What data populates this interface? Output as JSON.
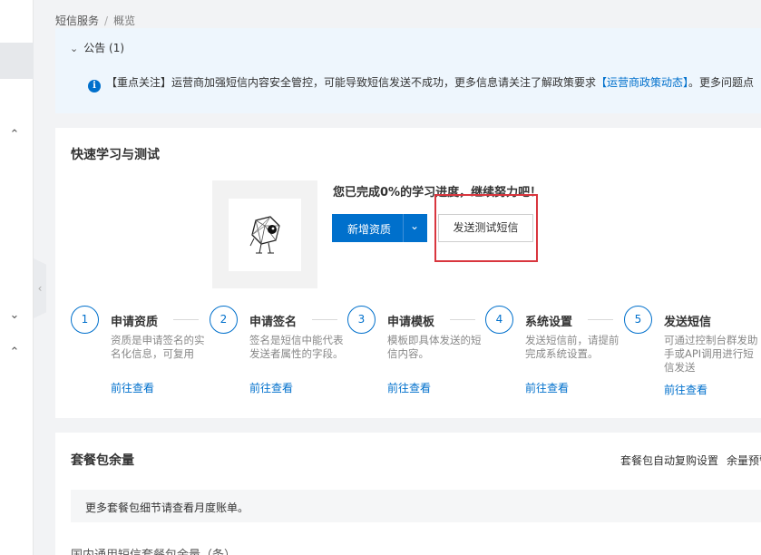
{
  "breadcrumb": {
    "root": "短信服务",
    "separator": "/",
    "current": "概览"
  },
  "notice": {
    "header": "公告 (1)",
    "text_part1": "【重点关注】运营商加强短信内容安全管控，可能导致短信发送不成功，更多信息请关注了解政策要求",
    "link": "【运营商政策动态】",
    "text_part2": "。更多问题点",
    "icon": "info-icon"
  },
  "quick_start": {
    "title": "快速学习与测试",
    "progress_text": "您已完成0%的学习进度，继续努力吧！",
    "add_qualification_button": "新增资质",
    "send_test_button": "发送测试短信",
    "steps": [
      {
        "num": "1",
        "title": "申请资质",
        "desc": "资质是申请签名的实名化信息，可复用",
        "link": "前往查看"
      },
      {
        "num": "2",
        "title": "申请签名",
        "desc": "签名是短信中能代表发送者属性的字段。",
        "link": "前往查看"
      },
      {
        "num": "3",
        "title": "申请模板",
        "desc": "模板即具体发送的短信内容。",
        "link": "前往查看"
      },
      {
        "num": "4",
        "title": "系统设置",
        "desc": "发送短信前，请提前完成系统设置。",
        "link": "前往查看"
      },
      {
        "num": "5",
        "title": "发送短信",
        "desc": "可通过控制台群发助手或API调用进行短信发送",
        "link": "前往查看"
      }
    ]
  },
  "package": {
    "title": "套餐包余量",
    "auto_renew_link": "套餐包自动复购设置",
    "balance_alert_link": "余量预警设",
    "bill_tip": "更多套餐包细节请查看月度账单。",
    "sub_title": "国内通用短信套餐包余量（条）"
  },
  "colors": {
    "primary": "#0070cc",
    "notice_bg": "#eef6fd",
    "highlight": "#d9363e"
  }
}
